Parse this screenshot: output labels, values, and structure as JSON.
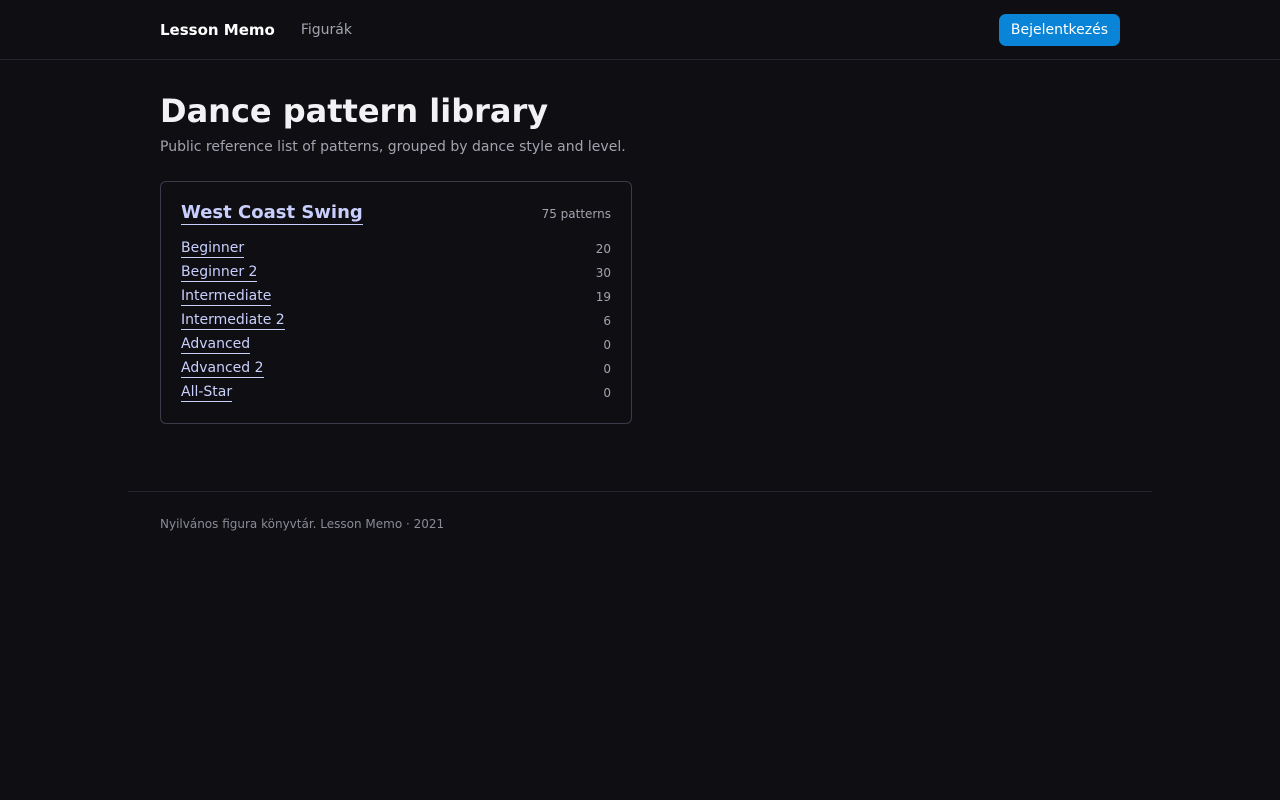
{
  "header": {
    "brand": "Lesson Memo",
    "nav_figures": "Figurák",
    "login_label": "Bejelentkezés"
  },
  "main": {
    "title": "Dance pattern library",
    "subtitle": "Public reference list of patterns, grouped by dance style and level.",
    "style": {
      "name": "West Coast Swing",
      "total": "75 patterns",
      "levels": [
        {
          "label": "Beginner",
          "count": "20"
        },
        {
          "label": "Beginner 2",
          "count": "30"
        },
        {
          "label": "Intermediate",
          "count": "19"
        },
        {
          "label": "Intermediate 2",
          "count": "6"
        },
        {
          "label": "Advanced",
          "count": "0"
        },
        {
          "label": "Advanced 2",
          "count": "0"
        },
        {
          "label": "All-Star",
          "count": "0"
        }
      ]
    }
  },
  "footer": {
    "text": "Nyilvános figura könyvtár. Lesson Memo · 2021"
  },
  "colors": {
    "background": "#0e0e13",
    "accent": "#0a84d6",
    "link": "#c9cffc"
  }
}
